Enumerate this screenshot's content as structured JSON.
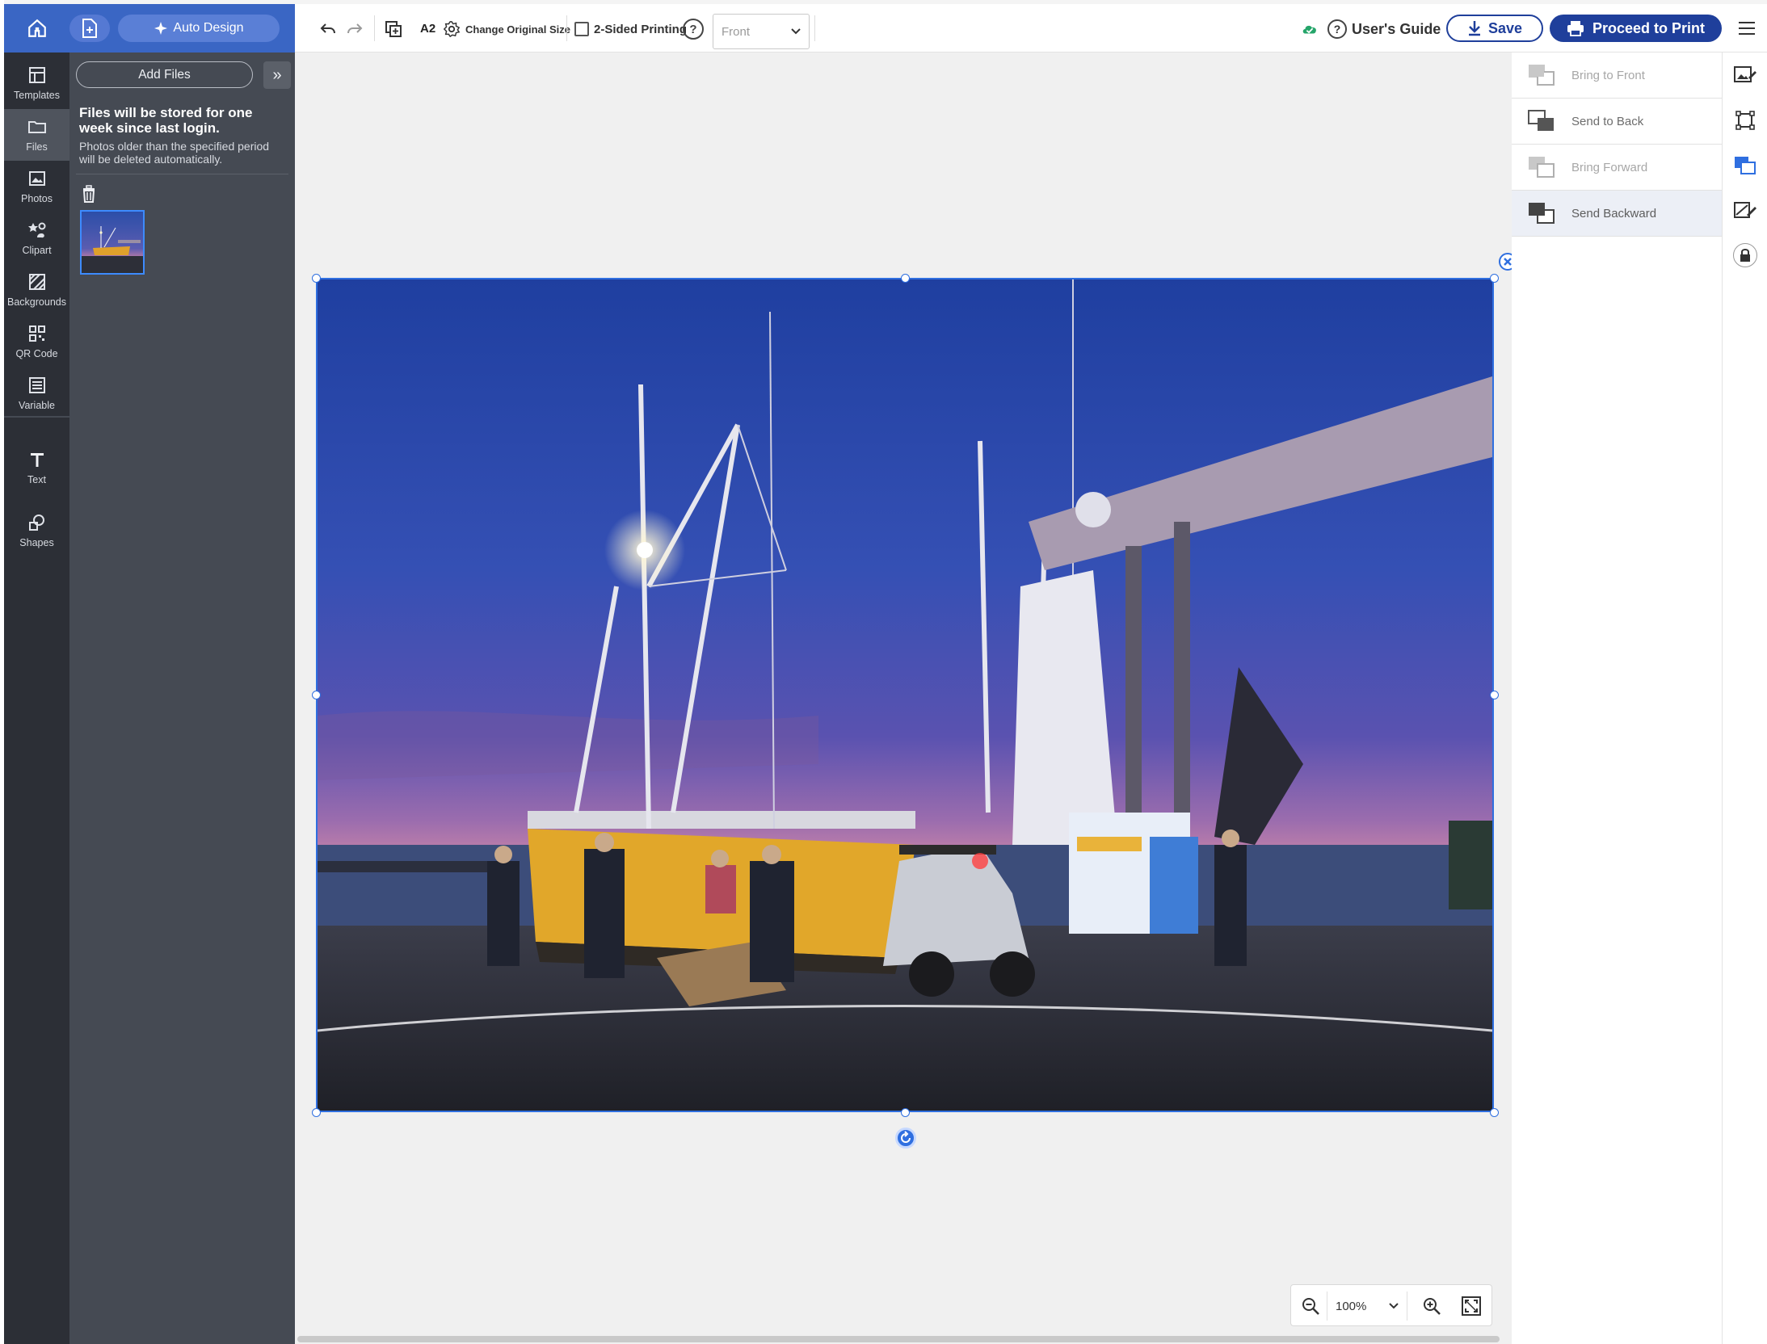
{
  "header": {
    "auto_design_label": "Auto Design"
  },
  "rail": {
    "items": [
      {
        "label": "Templates",
        "icon": "templates-icon"
      },
      {
        "label": "Files",
        "icon": "folder-icon"
      },
      {
        "label": "Photos",
        "icon": "photos-icon"
      },
      {
        "label": "Clipart",
        "icon": "clipart-icon"
      },
      {
        "label": "Backgrounds",
        "icon": "backgrounds-icon"
      },
      {
        "label": "QR Code",
        "icon": "qr-code-icon"
      },
      {
        "label": "Variable",
        "icon": "variable-icon"
      },
      {
        "label": "Text",
        "icon": "text-icon"
      },
      {
        "label": "Shapes",
        "icon": "shapes-icon"
      }
    ]
  },
  "files_panel": {
    "add_files_label": "Add Files",
    "collapse_label": "»",
    "storage_title": "Files will be stored for one week since last login.",
    "storage_description": "Photos older than the specified period will be deleted automatically."
  },
  "toolbar": {
    "paper_size": "A2",
    "change_size_label": "Change Original Size",
    "duplex_label": "2-Sided Printing",
    "duplex_checked": false,
    "side_select_value": "Front",
    "users_guide_label": "User's Guide",
    "save_label": "Save",
    "print_label": "Proceed to Print"
  },
  "arrange": {
    "items": [
      {
        "label": "Bring to Front",
        "state": "disabled"
      },
      {
        "label": "Send to Back",
        "state": "enabled"
      },
      {
        "label": "Bring Forward",
        "state": "disabled"
      },
      {
        "label": "Send Backward",
        "state": "hover"
      }
    ]
  },
  "zoom": {
    "value": "100%"
  },
  "colors": {
    "brand_blue": "#3a66c4",
    "primary_button": "#1f3f9b",
    "selection": "#2f6fe0"
  }
}
